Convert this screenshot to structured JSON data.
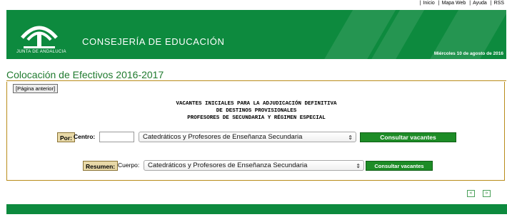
{
  "top_links": [
    "Inicio",
    "Mapa Web",
    "Ayuda",
    "RSS"
  ],
  "header": {
    "logo_text": "JUNTA DE ANDALUCIA",
    "department": "CONSEJERÍA DE EDUCACIÓN",
    "date": "Miércoles 10 de agosto de 2016"
  },
  "page_title": "Colocación de Efectivos 2016-2017",
  "prev_page": "[Página anterior]",
  "heading_lines": [
    "VACANTES INICIALES PARA LA ADJUDICACIÓN DEFINITIVA",
    "DE DESTINOS PROVISIONALES",
    "PROFESORES DE SECUNDARIA Y RÉGIMEN ESPECIAL"
  ],
  "por": {
    "tag": "Por:",
    "centro_label": "Centro:",
    "centro_value": "",
    "select_value": "Catedráticos y Profesores de Enseñanza Secundaria",
    "button": "Consultar vacantes"
  },
  "resumen": {
    "tag": "Resumen:",
    "cuerpo_label": "Cuerpo:",
    "select_value": "Catedráticos y Profesores de Enseñanza Secundaria",
    "button": "Consultar vacantes"
  },
  "pager": {
    "prev": "«",
    "next": "»"
  },
  "colors": {
    "brand_green": "#0d8a3e",
    "button_green": "#1d8c26",
    "border_gold": "#b98c1a"
  }
}
